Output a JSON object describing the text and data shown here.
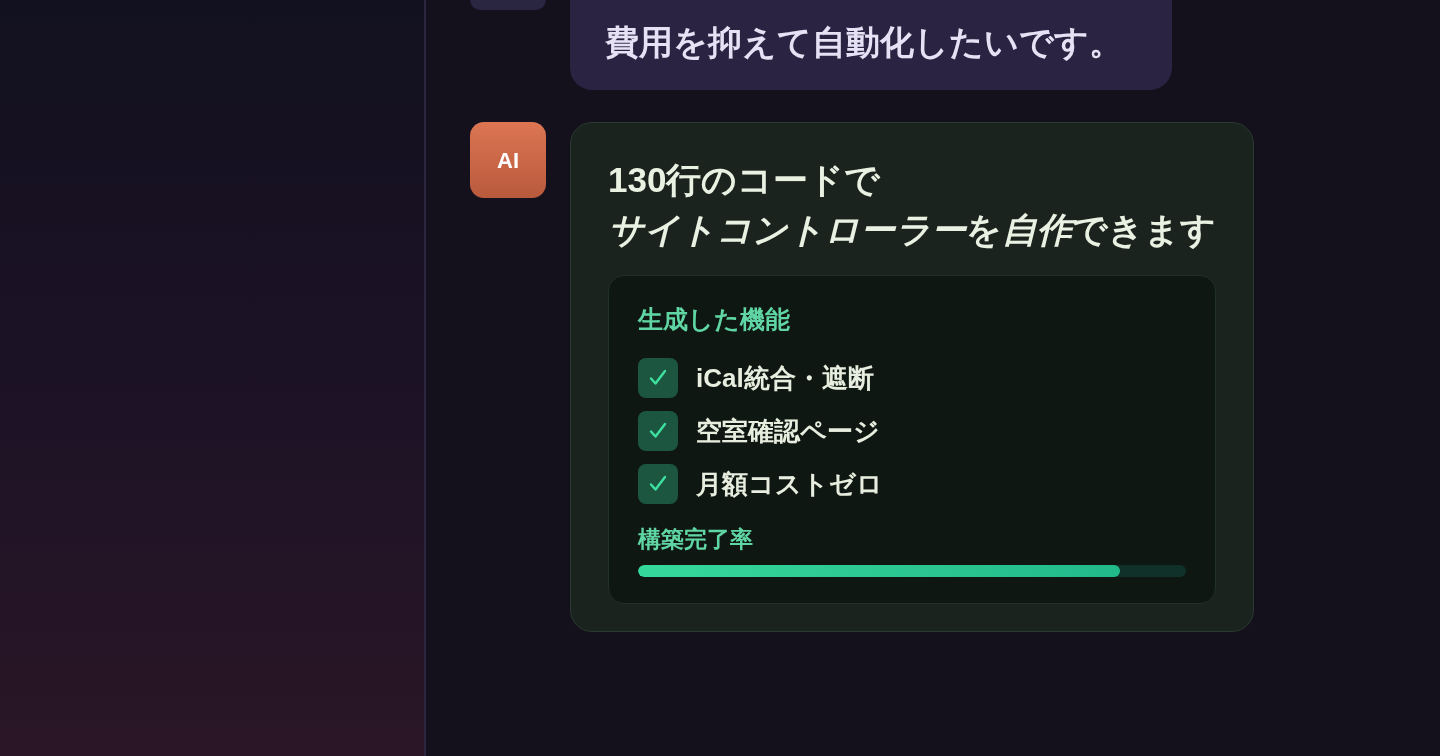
{
  "messages": [
    {
      "kind": "user",
      "text": "費用を抑えて自動化したいです。"
    },
    {
      "kind": "assistant",
      "avatar": "AI",
      "title_lines": [
        [
          {
            "text": "130行のコードで",
            "italic": false
          }
        ],
        [
          {
            "text": "サイトコントローラー",
            "italic": true
          },
          {
            "text": "を",
            "italic": false
          },
          {
            "text": "自作",
            "italic": true
          },
          {
            "text": "できます",
            "italic": false
          }
        ]
      ],
      "card": {
        "heading": "生成した機能",
        "features": [
          {
            "label": "iCal統合・遮断",
            "checked": true
          },
          {
            "label": "空室確認ページ",
            "checked": true
          },
          {
            "label": "月額コストゼロ",
            "checked": true
          }
        ],
        "progress": {
          "label": "構築完了率",
          "level": 0.88
        }
      }
    }
  ]
}
